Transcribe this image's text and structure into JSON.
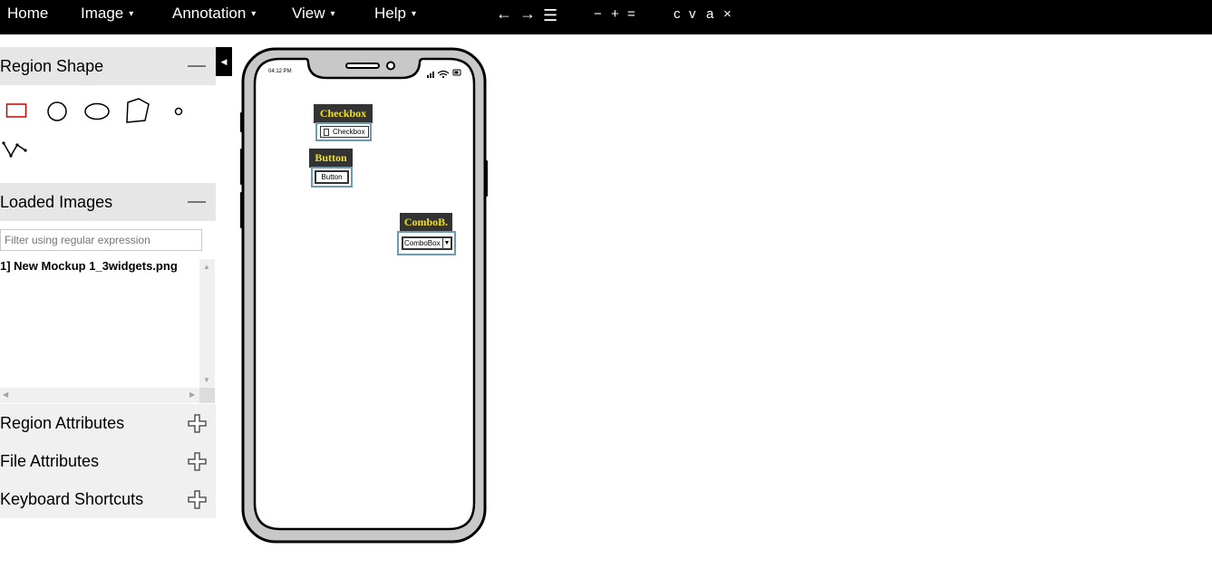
{
  "menu": {
    "items": [
      {
        "label": "Home",
        "has_dropdown": false
      },
      {
        "label": "Image",
        "has_dropdown": true
      },
      {
        "label": "Annotation",
        "has_dropdown": true
      },
      {
        "label": "View",
        "has_dropdown": true
      },
      {
        "label": "Help",
        "has_dropdown": true
      }
    ],
    "caret": "▾",
    "tools": {
      "prev": "←",
      "next": "→",
      "list": "☰",
      "zoom_out": "−",
      "zoom_in": "+",
      "zoom_reset": "=",
      "copy": "c",
      "paste": "v",
      "select_all": "a",
      "delete": "×"
    }
  },
  "sidebar": {
    "collapse_glyph": "◀",
    "region_shape": {
      "title": "Region Shape",
      "shapes": [
        "rectangle-icon",
        "circle-icon",
        "ellipse-icon",
        "polygon-icon",
        "point-icon",
        "polyline-icon"
      ],
      "selected": "rectangle-icon"
    },
    "loaded_images": {
      "title": "Loaded Images",
      "filter_placeholder": "Filter using regular expression",
      "files": [
        "1] New Mockup 1_3widgets.png"
      ]
    },
    "sections": [
      {
        "title": "Region Attributes"
      },
      {
        "title": "File Attributes"
      },
      {
        "title": "Keyboard Shortcuts"
      }
    ]
  },
  "canvas": {
    "status_time": "04:12 PM",
    "annotations": [
      {
        "label": "Checkbox",
        "widget_text": "Checkbox"
      },
      {
        "label": "Button",
        "widget_text": "Button"
      },
      {
        "label": "ComboB.",
        "widget_text": "ComboBox"
      }
    ]
  },
  "colors": {
    "menubar_bg": "#000000",
    "selected_shape": "#cc0000",
    "label_bg": "#333333",
    "label_text": "#f0e020",
    "region_border": "#6f9bb0"
  }
}
